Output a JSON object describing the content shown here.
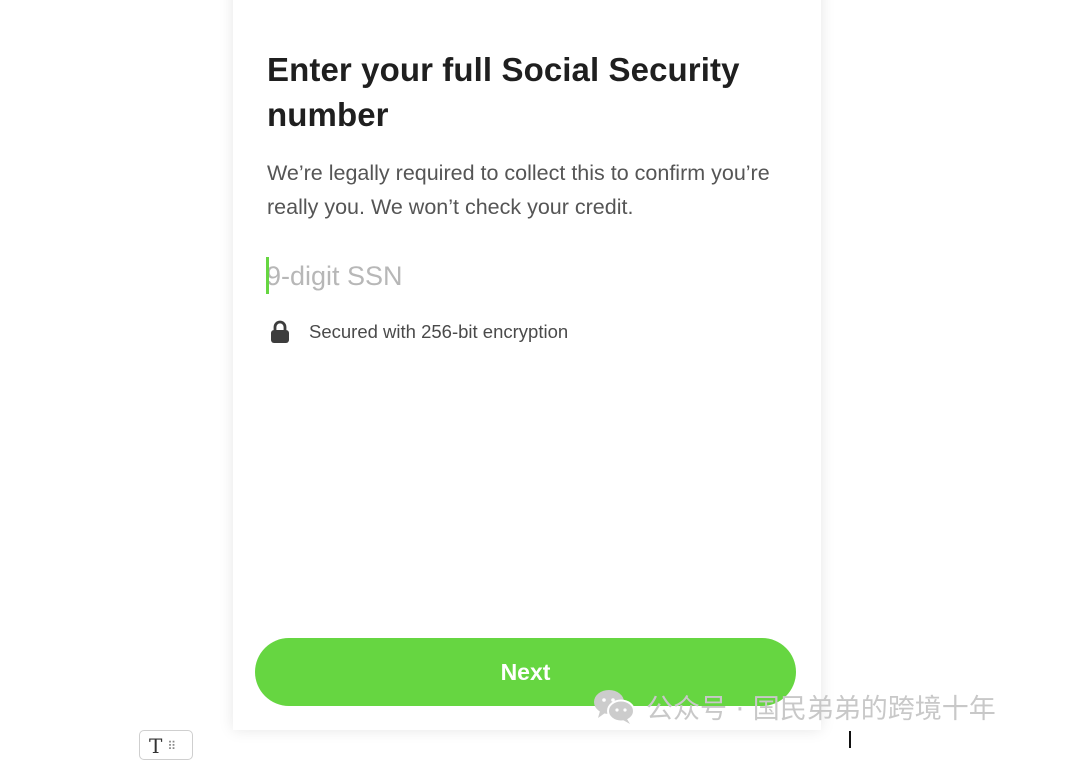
{
  "form": {
    "title": "Enter your full Social Security number",
    "description": "We’re legally required to collect this to confirm you’re really you. We won’t check your credit.",
    "ssn_input": {
      "value": "",
      "placeholder": "9-digit SSN"
    },
    "security_note": "Secured with 256-bit encryption",
    "next_label": "Next"
  },
  "watermark": {
    "text": "公众号 · 国民弟弟的跨境十年"
  },
  "editor_toolbar": {
    "label": "T",
    "grip": "⠿"
  },
  "icons": {
    "lock": "lock-icon",
    "wechat": "wechat-icon"
  },
  "colors": {
    "accent": "#66d641",
    "title_text": "#1f1f1f",
    "body_text": "#555555",
    "placeholder": "#b7b7b7"
  }
}
